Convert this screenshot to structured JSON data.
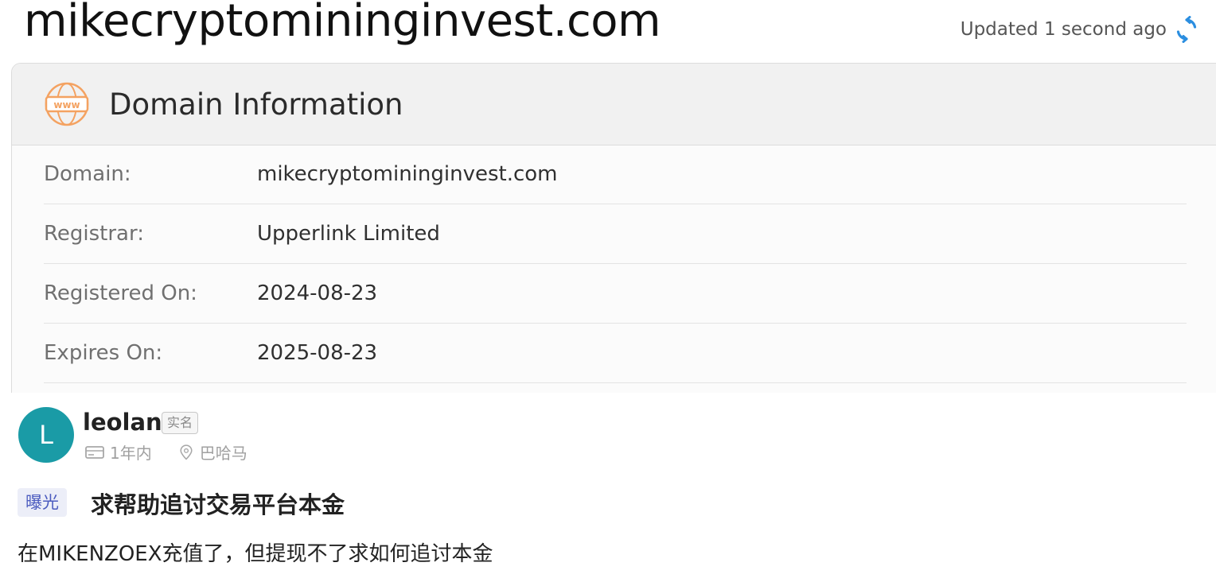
{
  "header": {
    "site_title": "mikecryptomininginvest.com",
    "updated_text": "Updated 1 second ago",
    "refresh_icon": "refresh-icon",
    "accent_color": "#2b8ee0"
  },
  "domain_card": {
    "title": "Domain Information",
    "icon": "www-globe-icon",
    "icon_color": "#f4a261",
    "rows": [
      {
        "label": "Domain:",
        "value": "mikecryptomininginvest.com"
      },
      {
        "label": "Registrar:",
        "value": "Upperlink Limited"
      },
      {
        "label": "Registered On:",
        "value": "2024-08-23"
      },
      {
        "label": "Expires On:",
        "value": "2025-08-23"
      }
    ]
  },
  "post": {
    "avatar_letter": "L",
    "avatar_color": "#1a9ba6",
    "username": "leolan",
    "verified_label": "实名",
    "time_icon": "card-icon",
    "time": "1年内",
    "location_icon": "location-pin-icon",
    "location": "巴哈马",
    "tag": "曝光",
    "title": "求帮助追讨交易平台本金",
    "body": "在MIKENZOEX充值了，但提现不了求如何追讨本金"
  }
}
